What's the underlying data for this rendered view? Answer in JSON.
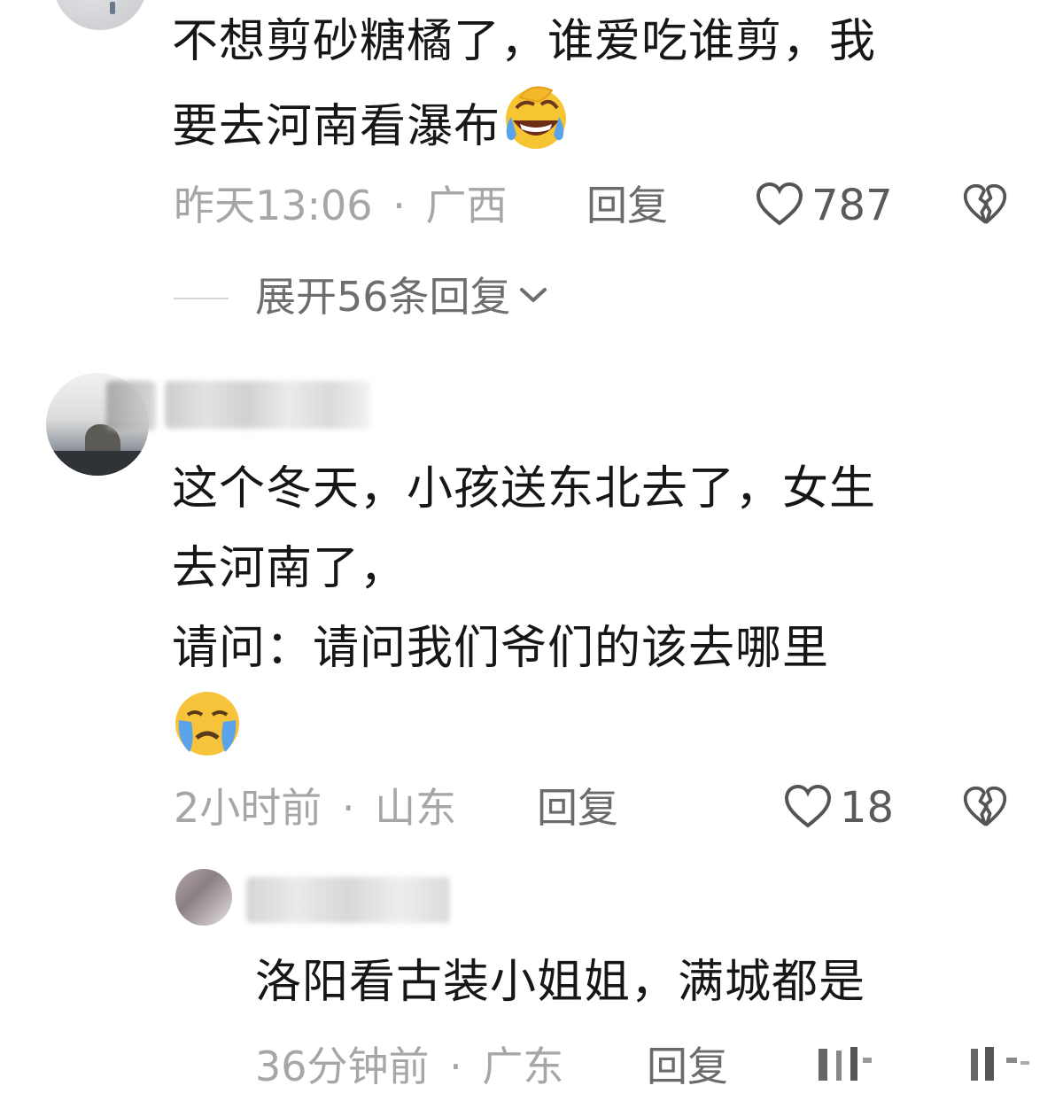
{
  "comments": [
    {
      "text_line1": "不想剪砂糖橘了，谁爱吃谁剪，我",
      "text_line2": "要去河南看瀑布",
      "emoji_icon": "laughing-crying-emoji",
      "time": "昨天13:06",
      "separator": "·",
      "location": "广西",
      "reply_label": "回复",
      "like_count": "787",
      "expand_label": "展开56条回复"
    },
    {
      "text_line1": "这个冬天，小孩送东北去了，女生",
      "text_line2": "去河南了，",
      "text_line3": "请问：请问我们爷们的该去哪里",
      "emoji_icon": "crying-emoji",
      "time": "2小时前",
      "separator": "·",
      "location": "山东",
      "reply_label": "回复",
      "like_count": "18"
    }
  ],
  "reply": {
    "text": "洛阳看古装小姐姐，满城都是",
    "time": "36分钟前",
    "separator": "·",
    "location": "广东",
    "reply_label": "回复"
  },
  "colors": {
    "text": "#161616",
    "meta": "#a6a6a6",
    "action": "#6b6b6b"
  },
  "icons": [
    "heart-icon",
    "broken-heart-icon",
    "chevron-down-icon"
  ]
}
